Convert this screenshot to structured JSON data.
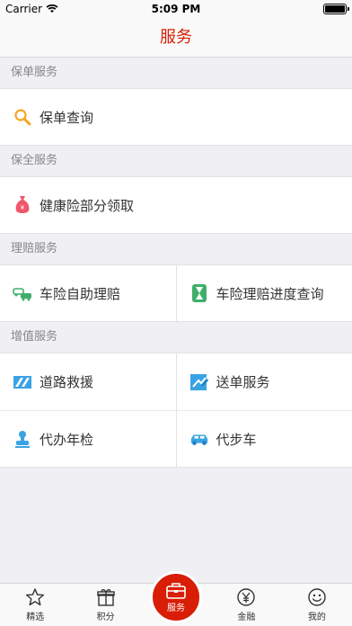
{
  "status_bar": {
    "carrier": "Carrier",
    "time": "5:09 PM"
  },
  "nav": {
    "title": "服务"
  },
  "sections": {
    "policy": {
      "header": "保单服务",
      "items": [
        {
          "label": "保单查询",
          "icon": "search-icon"
        }
      ]
    },
    "preservation": {
      "header": "保全服务",
      "items": [
        {
          "label": "健康险部分领取",
          "icon": "money-bag-icon"
        }
      ]
    },
    "claims": {
      "header": "理赔服务",
      "items": [
        {
          "label": "车险自助理赔",
          "icon": "car-crash-icon"
        },
        {
          "label": "车险理赔进度查询",
          "icon": "hourglass-icon"
        }
      ]
    },
    "value_added": {
      "header": "增值服务",
      "items": [
        {
          "label": "道路救援",
          "icon": "roadblock-icon"
        },
        {
          "label": "送单服务",
          "icon": "document-delivery-icon"
        },
        {
          "label": "代办年检",
          "icon": "stamp-icon"
        },
        {
          "label": "代步车",
          "icon": "car-icon"
        }
      ]
    }
  },
  "tab_bar": {
    "items": [
      {
        "label": "精选",
        "icon": "star-icon"
      },
      {
        "label": "积分",
        "icon": "gift-icon"
      },
      {
        "label": "服务",
        "icon": "briefcase-icon"
      },
      {
        "label": "金融",
        "icon": "yen-icon"
      },
      {
        "label": "我的",
        "icon": "smiley-icon"
      }
    ]
  },
  "colors": {
    "brand_red": "#d81e06",
    "icon_orange": "#f5a623",
    "icon_green": "#3fae6b",
    "icon_blue": "#3aa3e3"
  }
}
